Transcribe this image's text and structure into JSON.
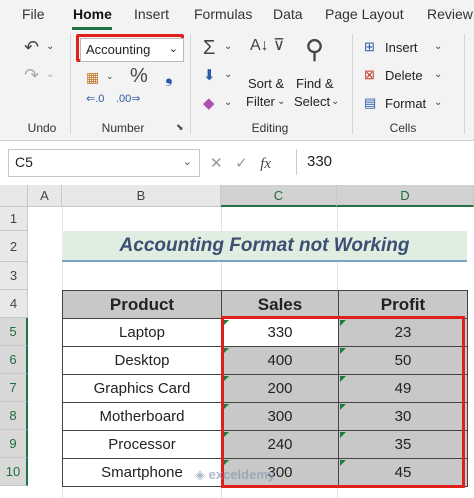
{
  "tabs": [
    "File",
    "Home",
    "Insert",
    "Formulas",
    "Data",
    "Page Layout",
    "Review"
  ],
  "ribbon": {
    "number_format": "Accounting",
    "groups": {
      "undo": "Undo",
      "number": "Number",
      "editing": "Editing",
      "cells": "Cells"
    },
    "percent_symbol": "%",
    "sort_label": "Sort &",
    "filter_label": "Filter",
    "find_label": "Find &",
    "select_label": "Select",
    "insert_label": "Insert",
    "delete_label": "Delete",
    "format_label": "Format"
  },
  "formula_bar": {
    "name_box": "C5",
    "fx": "fx",
    "value": "330"
  },
  "columns": [
    "A",
    "B",
    "C",
    "D"
  ],
  "rows": [
    "1",
    "2",
    "3",
    "4",
    "5",
    "6",
    "7",
    "8",
    "9",
    "10"
  ],
  "sheet": {
    "title": "Accounting Format not Working",
    "headers": [
      "Product",
      "Sales",
      "Profit"
    ],
    "data": [
      [
        "Laptop",
        "330",
        "23"
      ],
      [
        "Desktop",
        "400",
        "50"
      ],
      [
        "Graphics Card",
        "200",
        "49"
      ],
      [
        "Motherboard",
        "300",
        "30"
      ],
      [
        "Processor",
        "240",
        "35"
      ],
      [
        "Smartphone",
        "300",
        "45"
      ]
    ]
  },
  "watermark": "exceldemy",
  "colors": {
    "accent": "#217346",
    "highlight": "#e0201b"
  }
}
